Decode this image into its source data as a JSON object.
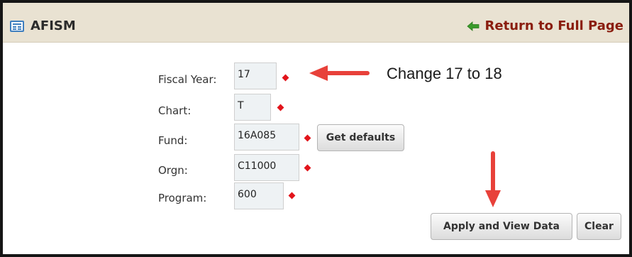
{
  "header": {
    "app_icon": "list-window-icon",
    "title": "AFISM",
    "return_icon": "left-arrow-icon",
    "return_label": "Return to Full Page"
  },
  "form": {
    "fields": [
      {
        "label": "Fiscal Year:",
        "value": "17"
      },
      {
        "label": "Chart:",
        "value": "T"
      },
      {
        "label": "Fund:",
        "value": "16A085"
      },
      {
        "label": "Orgn:",
        "value": "C11000"
      },
      {
        "label": "Program:",
        "value": "600"
      }
    ],
    "get_defaults_label": "Get defaults",
    "apply_label": "Apply and View Data",
    "clear_label": "Clear"
  },
  "annotation": {
    "text": "Change 17 to 18"
  },
  "colors": {
    "header_bg": "#e9e2d2",
    "return_link": "#8a1d0e",
    "required_marker": "#e2141b",
    "annotation_arrow": "#e8413a",
    "return_arrow": "#3a9a2a"
  }
}
